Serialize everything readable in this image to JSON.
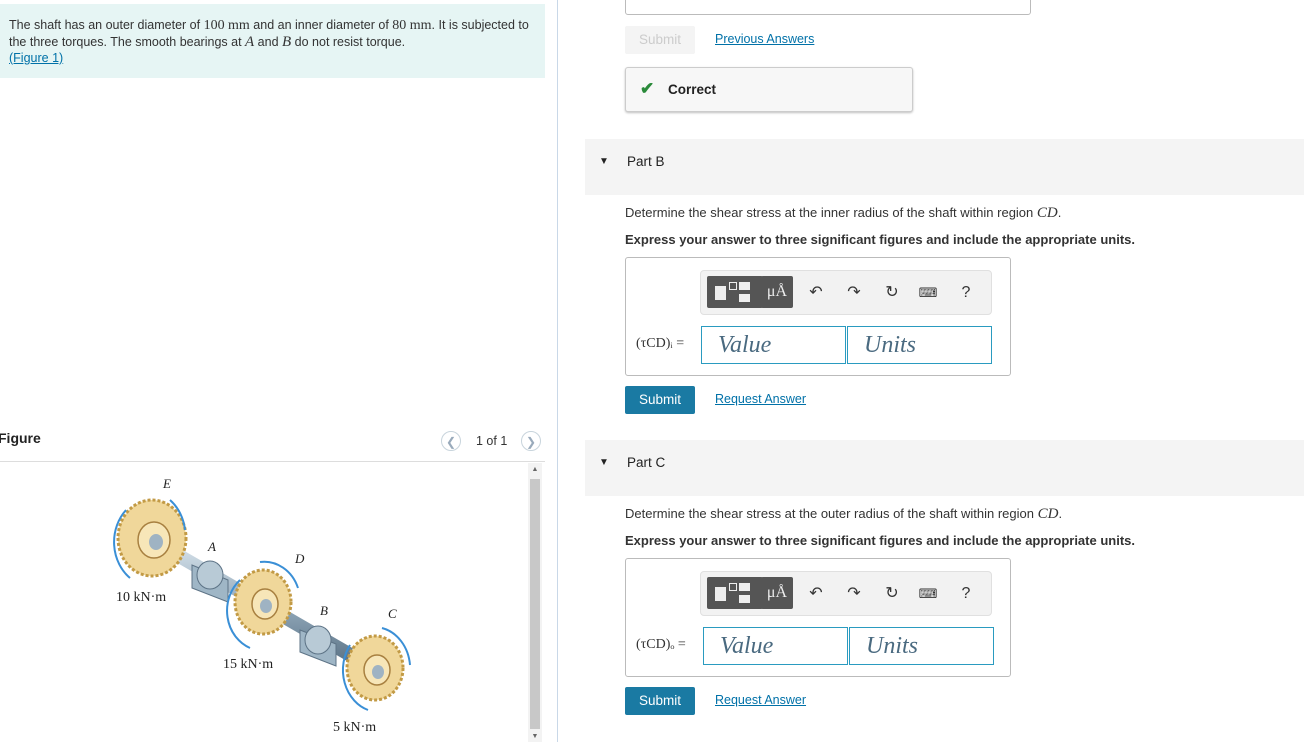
{
  "problem": {
    "text_1": "The shaft has an outer diameter of ",
    "outer_value": "100",
    "unit_mm": "mm",
    "text_2": " and an inner diameter of ",
    "inner_value": "80",
    "text_3": ". It is subjected to the three torques. The smooth bearings at ",
    "point_a": "A",
    "text_and": " and ",
    "point_b": "B",
    "text_4": " do not resist torque.",
    "figure_link": "(Figure 1)"
  },
  "figure": {
    "title": "Figure",
    "pager": "1 of 1",
    "labels": {
      "E": "E",
      "A": "A",
      "D": "D",
      "B": "B",
      "C": "C",
      "torque_10": "10 kN·m",
      "torque_15": "15 kN·m",
      "torque_5": "5 kN·m"
    }
  },
  "part_a": {
    "submit_label": "Submit",
    "previous_answers": "Previous Answers",
    "status": "Correct"
  },
  "part_b": {
    "title": "Part B",
    "question_1": "Determine the shear stress at the inner radius of the shaft within region ",
    "region": "CD",
    "question_2": ".",
    "instruction": "Express your answer to three significant figures and include the appropriate units.",
    "var_label": "(τCD)ᵢ =",
    "value_placeholder": "Value",
    "units_placeholder": "Units",
    "submit_label": "Submit",
    "request_answer": "Request Answer"
  },
  "part_c": {
    "title": "Part C",
    "question_1": "Determine the shear stress at the outer radius of the shaft within region ",
    "region": "CD",
    "question_2": ".",
    "instruction": "Express your answer to three significant figures and include the appropriate units.",
    "var_label": "(τCD)ₒ =",
    "value_placeholder": "Value",
    "units_placeholder": "Units",
    "submit_label": "Submit",
    "request_answer": "Request Answer"
  },
  "toolbar": {
    "mu_label": "μÅ",
    "help_label": "?",
    "icons": [
      "templates-icon",
      "units-icon",
      "undo-icon",
      "redo-icon",
      "reset-icon",
      "keyboard-icon",
      "help-icon"
    ]
  },
  "colors": {
    "accent": "#1a7aa3",
    "link": "#0071a8",
    "correct_check": "#2a8a3a",
    "problem_bg": "#e6f5f4"
  }
}
